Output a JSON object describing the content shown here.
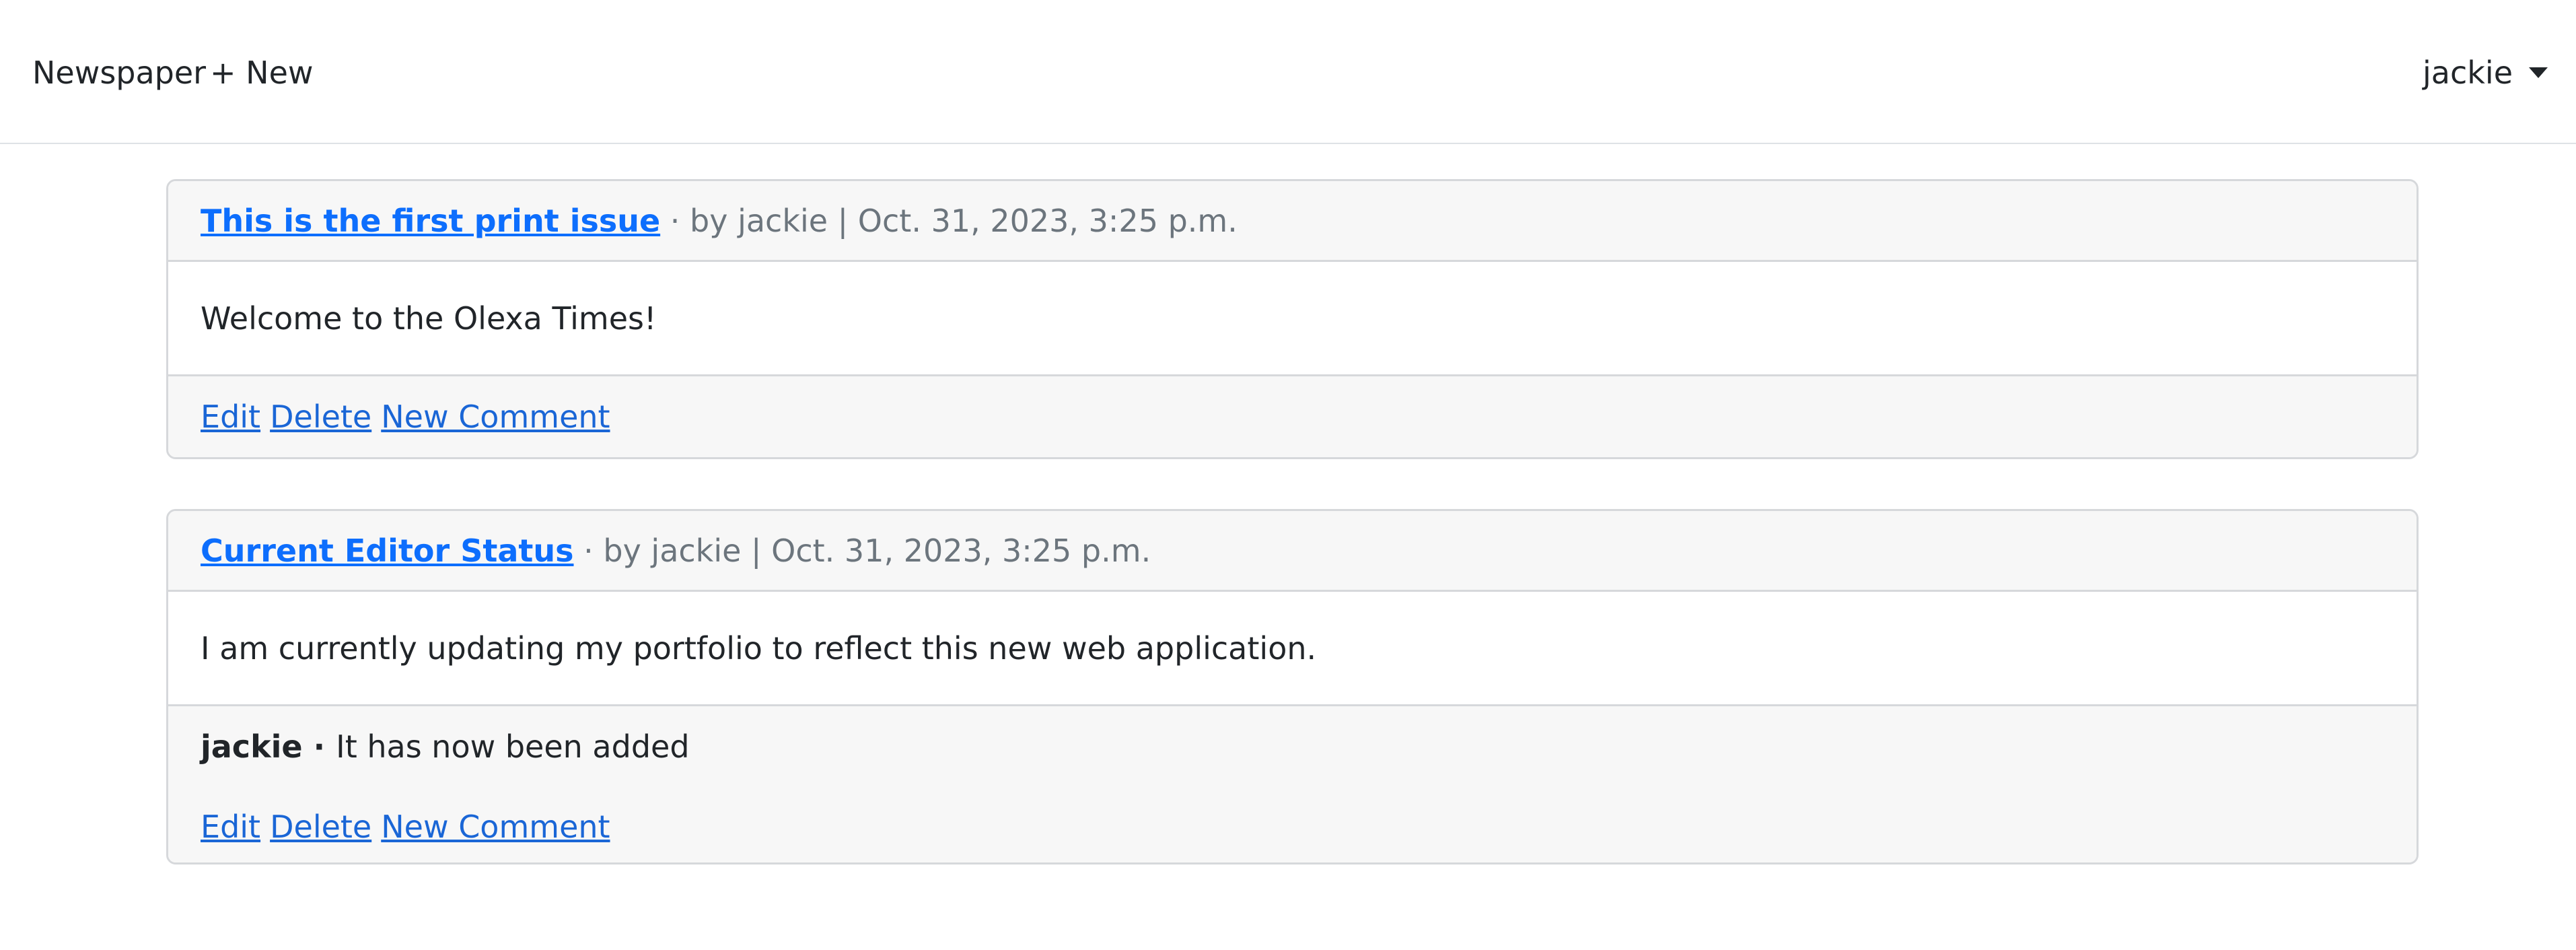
{
  "navbar": {
    "brand": "Newspaper",
    "new_label": "+ New",
    "user": "jackie"
  },
  "posts": [
    {
      "title": "This is the first print issue",
      "meta": " · by jackie | Oct. 31, 2023, 3:25 p.m.",
      "body": "Welcome to the Olexa Times!",
      "comments": [],
      "actions": {
        "edit": "Edit",
        "delete": "Delete",
        "new_comment": "New Comment"
      }
    },
    {
      "title": "Current Editor Status",
      "meta": " · by jackie | Oct. 31, 2023, 3:25 p.m.",
      "body": "I am currently updating my portfolio to reflect this new web application.",
      "comments": [
        {
          "author": "jackie",
          "separator": " · ",
          "text": "It has now been added"
        }
      ],
      "actions": {
        "edit": "Edit",
        "delete": "Delete",
        "new_comment": "New Comment"
      }
    }
  ]
}
